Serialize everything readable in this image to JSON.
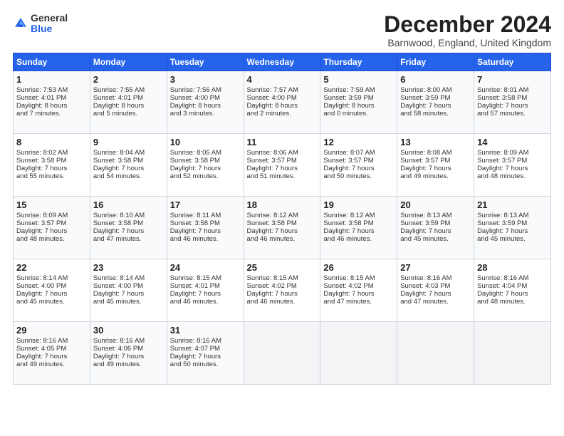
{
  "logo": {
    "general": "General",
    "blue": "Blue"
  },
  "header": {
    "month": "December 2024",
    "location": "Barnwood, England, United Kingdom"
  },
  "days_of_week": [
    "Sunday",
    "Monday",
    "Tuesday",
    "Wednesday",
    "Thursday",
    "Friday",
    "Saturday"
  ],
  "weeks": [
    [
      {
        "day": "1",
        "lines": [
          "Sunrise: 7:53 AM",
          "Sunset: 4:01 PM",
          "Daylight: 8 hours",
          "and 7 minutes."
        ]
      },
      {
        "day": "2",
        "lines": [
          "Sunrise: 7:55 AM",
          "Sunset: 4:01 PM",
          "Daylight: 8 hours",
          "and 5 minutes."
        ]
      },
      {
        "day": "3",
        "lines": [
          "Sunrise: 7:56 AM",
          "Sunset: 4:00 PM",
          "Daylight: 8 hours",
          "and 3 minutes."
        ]
      },
      {
        "day": "4",
        "lines": [
          "Sunrise: 7:57 AM",
          "Sunset: 4:00 PM",
          "Daylight: 8 hours",
          "and 2 minutes."
        ]
      },
      {
        "day": "5",
        "lines": [
          "Sunrise: 7:59 AM",
          "Sunset: 3:59 PM",
          "Daylight: 8 hours",
          "and 0 minutes."
        ]
      },
      {
        "day": "6",
        "lines": [
          "Sunrise: 8:00 AM",
          "Sunset: 3:59 PM",
          "Daylight: 7 hours",
          "and 58 minutes."
        ]
      },
      {
        "day": "7",
        "lines": [
          "Sunrise: 8:01 AM",
          "Sunset: 3:58 PM",
          "Daylight: 7 hours",
          "and 57 minutes."
        ]
      }
    ],
    [
      {
        "day": "8",
        "lines": [
          "Sunrise: 8:02 AM",
          "Sunset: 3:58 PM",
          "Daylight: 7 hours",
          "and 55 minutes."
        ]
      },
      {
        "day": "9",
        "lines": [
          "Sunrise: 8:04 AM",
          "Sunset: 3:58 PM",
          "Daylight: 7 hours",
          "and 54 minutes."
        ]
      },
      {
        "day": "10",
        "lines": [
          "Sunrise: 8:05 AM",
          "Sunset: 3:58 PM",
          "Daylight: 7 hours",
          "and 52 minutes."
        ]
      },
      {
        "day": "11",
        "lines": [
          "Sunrise: 8:06 AM",
          "Sunset: 3:57 PM",
          "Daylight: 7 hours",
          "and 51 minutes."
        ]
      },
      {
        "day": "12",
        "lines": [
          "Sunrise: 8:07 AM",
          "Sunset: 3:57 PM",
          "Daylight: 7 hours",
          "and 50 minutes."
        ]
      },
      {
        "day": "13",
        "lines": [
          "Sunrise: 8:08 AM",
          "Sunset: 3:57 PM",
          "Daylight: 7 hours",
          "and 49 minutes."
        ]
      },
      {
        "day": "14",
        "lines": [
          "Sunrise: 8:09 AM",
          "Sunset: 3:57 PM",
          "Daylight: 7 hours",
          "and 48 minutes."
        ]
      }
    ],
    [
      {
        "day": "15",
        "lines": [
          "Sunrise: 8:09 AM",
          "Sunset: 3:57 PM",
          "Daylight: 7 hours",
          "and 48 minutes."
        ]
      },
      {
        "day": "16",
        "lines": [
          "Sunrise: 8:10 AM",
          "Sunset: 3:58 PM",
          "Daylight: 7 hours",
          "and 47 minutes."
        ]
      },
      {
        "day": "17",
        "lines": [
          "Sunrise: 8:11 AM",
          "Sunset: 3:58 PM",
          "Daylight: 7 hours",
          "and 46 minutes."
        ]
      },
      {
        "day": "18",
        "lines": [
          "Sunrise: 8:12 AM",
          "Sunset: 3:58 PM",
          "Daylight: 7 hours",
          "and 46 minutes."
        ]
      },
      {
        "day": "19",
        "lines": [
          "Sunrise: 8:12 AM",
          "Sunset: 3:58 PM",
          "Daylight: 7 hours",
          "and 46 minutes."
        ]
      },
      {
        "day": "20",
        "lines": [
          "Sunrise: 8:13 AM",
          "Sunset: 3:59 PM",
          "Daylight: 7 hours",
          "and 45 minutes."
        ]
      },
      {
        "day": "21",
        "lines": [
          "Sunrise: 8:13 AM",
          "Sunset: 3:59 PM",
          "Daylight: 7 hours",
          "and 45 minutes."
        ]
      }
    ],
    [
      {
        "day": "22",
        "lines": [
          "Sunrise: 8:14 AM",
          "Sunset: 4:00 PM",
          "Daylight: 7 hours",
          "and 45 minutes."
        ]
      },
      {
        "day": "23",
        "lines": [
          "Sunrise: 8:14 AM",
          "Sunset: 4:00 PM",
          "Daylight: 7 hours",
          "and 45 minutes."
        ]
      },
      {
        "day": "24",
        "lines": [
          "Sunrise: 8:15 AM",
          "Sunset: 4:01 PM",
          "Daylight: 7 hours",
          "and 46 minutes."
        ]
      },
      {
        "day": "25",
        "lines": [
          "Sunrise: 8:15 AM",
          "Sunset: 4:02 PM",
          "Daylight: 7 hours",
          "and 46 minutes."
        ]
      },
      {
        "day": "26",
        "lines": [
          "Sunrise: 8:15 AM",
          "Sunset: 4:02 PM",
          "Daylight: 7 hours",
          "and 47 minutes."
        ]
      },
      {
        "day": "27",
        "lines": [
          "Sunrise: 8:16 AM",
          "Sunset: 4:03 PM",
          "Daylight: 7 hours",
          "and 47 minutes."
        ]
      },
      {
        "day": "28",
        "lines": [
          "Sunrise: 8:16 AM",
          "Sunset: 4:04 PM",
          "Daylight: 7 hours",
          "and 48 minutes."
        ]
      }
    ],
    [
      {
        "day": "29",
        "lines": [
          "Sunrise: 8:16 AM",
          "Sunset: 4:05 PM",
          "Daylight: 7 hours",
          "and 49 minutes."
        ]
      },
      {
        "day": "30",
        "lines": [
          "Sunrise: 8:16 AM",
          "Sunset: 4:06 PM",
          "Daylight: 7 hours",
          "and 49 minutes."
        ]
      },
      {
        "day": "31",
        "lines": [
          "Sunrise: 8:16 AM",
          "Sunset: 4:07 PM",
          "Daylight: 7 hours",
          "and 50 minutes."
        ]
      },
      {
        "day": "",
        "lines": []
      },
      {
        "day": "",
        "lines": []
      },
      {
        "day": "",
        "lines": []
      },
      {
        "day": "",
        "lines": []
      }
    ]
  ]
}
